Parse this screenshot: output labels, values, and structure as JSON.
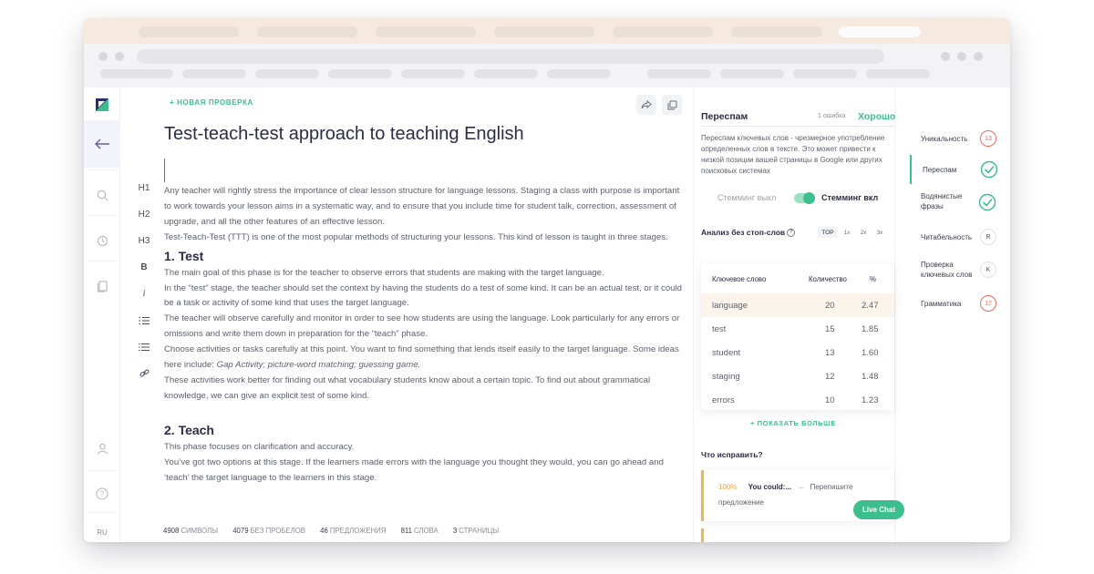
{
  "editor": {
    "new_check": "+ НОВАЯ ПРОВЕРКА",
    "title": "Test-teach-test approach to teaching English",
    "paragraphs": {
      "p1": "Any teacher will rightly stress the importance of clear lesson structure for language lessons. Staging a class with purpose is important to work towards your lesson aims in a systematic way, and to ensure that you include time for student talk, correction, assessment of upgrade, and all the other features of an effective lesson.",
      "p2": "Test-Teach-Test (TTT) is one of the most popular methods of structuring your lessons. This kind of lesson is taught in three stages.",
      "h_test": "1. Test",
      "p3": "The main goal of this phase is for the teacher to observe errors that students are making with the target language.",
      "p4": "In the “test” stage, the teacher should set the context by having the students do a test of some kind. It can be an actual test, or it could be a task or activity of some kind that uses the target language.",
      "p5": "The teacher will observe carefully and monitor in order to see how students are using the language. Look particularly for any errors or omissions and write them down in preparation for the “teach” phase.",
      "p6a": "Choose activities or tasks carefully at this point. You want to find something that lends itself easily to the target language. Some ideas here include: ",
      "p6b": "Gap Activity; picture-word matching; guessing game.",
      "p7": "These activities work better for finding out what vocabulary students know about a certain topic. To find out about grammatical knowledge, we can give an explicit test of some kind.",
      "h_teach": "2. Teach",
      "p8": "This phase focuses on clarification and accuracy.",
      "p9": "You’ve got two options at this stage. If the learners made errors with the language you thought they would, you can go ahead and ‘teach’ the target language to the learners in this stage."
    },
    "stats": [
      {
        "value": "4908",
        "label": "СИМВОЛЫ"
      },
      {
        "value": "4079",
        "label": "БЕЗ ПРОБЕЛОВ"
      },
      {
        "value": "46",
        "label": "ПРЕДЛОЖЕНИЯ"
      },
      {
        "value": "811",
        "label": "СЛОВА"
      },
      {
        "value": "3",
        "label": "СТРАНИЦЫ"
      }
    ]
  },
  "format_toolbar": [
    "H1",
    "H2",
    "H3",
    "B",
    "i"
  ],
  "rail": {
    "lang": "RU"
  },
  "panel": {
    "title": "Переспам",
    "errors": "1 ошибка",
    "status": "Хорошо",
    "description": "Переспам ключевых слов - чрезмерное употребление определенных слов в тексте. Это может привести к низкой позиции вашей страницы в Google или других поисковых системах",
    "stemming_off": "Стемминг выкл",
    "stemming_on": "Стемминг вкл",
    "stemming_enabled": true,
    "stopwords_title": "Анализ без стоп-слов",
    "segments": [
      "TOP",
      "1x",
      "2x",
      "3x"
    ],
    "table": {
      "headers": [
        "Ключевое слово",
        "Количество",
        "%"
      ],
      "rows": [
        {
          "word": "language",
          "count": "20",
          "pct": "2.47"
        },
        {
          "word": "test",
          "count": "15",
          "pct": "1.85"
        },
        {
          "word": "student",
          "count": "13",
          "pct": "1.60"
        },
        {
          "word": "staging",
          "count": "12",
          "pct": "1.48"
        },
        {
          "word": "errors",
          "count": "10",
          "pct": "1.23"
        }
      ]
    },
    "show_more": "+ ПОКАЗАТЬ БОЛЬШЕ",
    "fix_title": "Что исправить?",
    "fix": {
      "pct": "100%",
      "you_could": "You could:...",
      "arrow": "→",
      "action": "Перепишите",
      "action2": "предложение"
    }
  },
  "menu": [
    {
      "label": "Уникальность",
      "badge": "13"
    },
    {
      "label": "Переспам",
      "badge": ""
    },
    {
      "label": "Водянистые фразы",
      "badge": ""
    },
    {
      "label": "Читабельность",
      "badge": "R"
    },
    {
      "label": "Проверка ключевых слов",
      "badge": "K"
    },
    {
      "label": "Грамматика",
      "badge": "17"
    }
  ],
  "live_chat": "Live Chat",
  "colors": {
    "accent": "#3cbf8c",
    "warning": "#f0b45a",
    "error": "#ef6b5b",
    "logo": "#2a2d6b"
  }
}
